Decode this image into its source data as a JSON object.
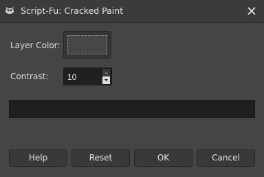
{
  "window": {
    "title": "Script-Fu: Cracked Paint",
    "app_icon": "gimp-wilber-icon",
    "close_icon": "close-icon"
  },
  "form": {
    "layer_color": {
      "label": "Layer Color:",
      "value_color": "#474747"
    },
    "contrast": {
      "label": "Contrast:",
      "value": "10",
      "up_icon": "spin-up-icon",
      "down_icon": "spin-down-icon"
    },
    "progress": {
      "value": 0
    }
  },
  "buttons": {
    "help": "Help",
    "reset": "Reset",
    "ok": "OK",
    "cancel": "Cancel"
  },
  "colors": {
    "background": "#454545",
    "titlebar": "#3b3b3b",
    "text": "#dcdcdc"
  }
}
